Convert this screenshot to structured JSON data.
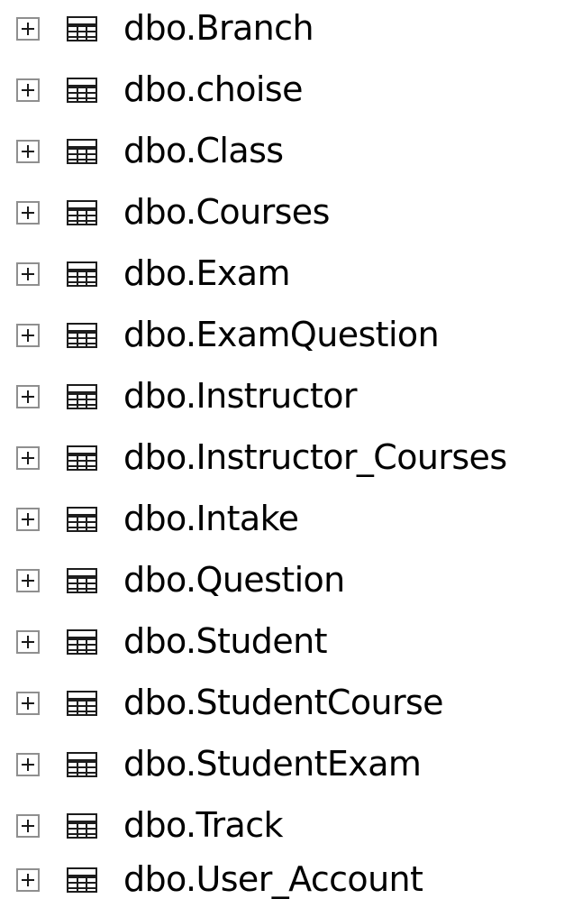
{
  "tree": {
    "items": [
      {
        "label": "dbo.Branch",
        "icon": "table-icon",
        "expander": "expand-icon"
      },
      {
        "label": "dbo.choise",
        "icon": "table-icon",
        "expander": "expand-icon"
      },
      {
        "label": "dbo.Class",
        "icon": "table-icon",
        "expander": "expand-icon"
      },
      {
        "label": "dbo.Courses",
        "icon": "table-icon",
        "expander": "expand-icon"
      },
      {
        "label": "dbo.Exam",
        "icon": "table-icon",
        "expander": "expand-icon"
      },
      {
        "label": "dbo.ExamQuestion",
        "icon": "table-icon",
        "expander": "expand-icon"
      },
      {
        "label": "dbo.Instructor",
        "icon": "table-icon",
        "expander": "expand-icon"
      },
      {
        "label": "dbo.Instructor_Courses",
        "icon": "table-icon",
        "expander": "expand-icon"
      },
      {
        "label": "dbo.Intake",
        "icon": "table-icon",
        "expander": "expand-icon"
      },
      {
        "label": "dbo.Question",
        "icon": "table-icon",
        "expander": "expand-icon"
      },
      {
        "label": "dbo.Student",
        "icon": "table-icon",
        "expander": "expand-icon"
      },
      {
        "label": "dbo.StudentCourse",
        "icon": "table-icon",
        "expander": "expand-icon"
      },
      {
        "label": "dbo.StudentExam",
        "icon": "table-icon",
        "expander": "expand-icon"
      },
      {
        "label": "dbo.Track",
        "icon": "table-icon",
        "expander": "expand-icon"
      },
      {
        "label": "dbo.User_Account",
        "icon": "table-icon",
        "expander": "expand-icon"
      }
    ]
  }
}
